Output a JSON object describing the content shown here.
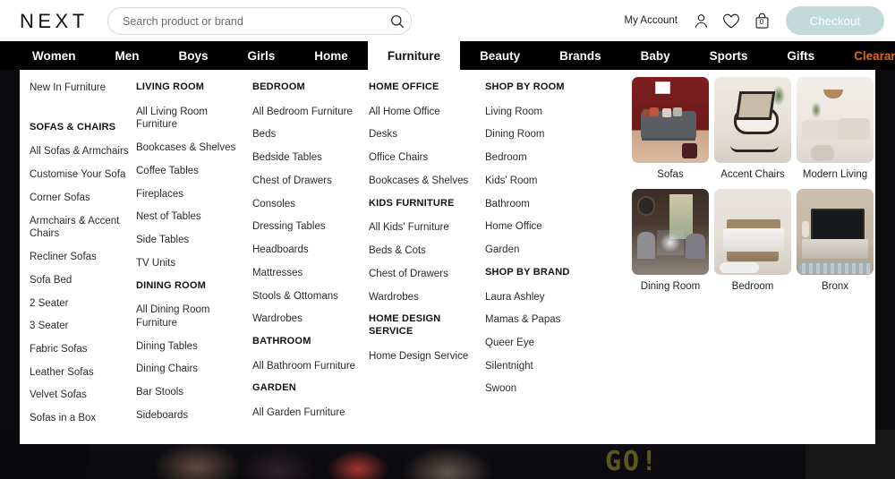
{
  "header": {
    "logo": "NEXT",
    "search": {
      "placeholder": "Search product or brand",
      "value": "",
      "icon": "search-icon"
    },
    "my_account": "My Account",
    "account_icon": "user-icon",
    "wishlist_icon": "heart-icon",
    "bag_icon": "bag-icon",
    "bag_count": "0",
    "checkout_label": "Checkout",
    "checkout_color": "#c2dadb"
  },
  "nav": {
    "items": [
      {
        "label": "Women",
        "active": false
      },
      {
        "label": "Men",
        "active": false
      },
      {
        "label": "Boys",
        "active": false
      },
      {
        "label": "Girls",
        "active": false
      },
      {
        "label": "Home",
        "active": false
      },
      {
        "label": "Furniture",
        "active": true
      },
      {
        "label": "Beauty",
        "active": false
      },
      {
        "label": "Brands",
        "active": false
      },
      {
        "label": "Baby",
        "active": false
      },
      {
        "label": "Sports",
        "active": false
      },
      {
        "label": "Gifts",
        "active": false
      },
      {
        "label": "Clearance",
        "active": false,
        "accent": "#e06a1c"
      }
    ]
  },
  "mega_menu": {
    "col1": {
      "top_link": "New In Furniture",
      "heading": "SOFAS & CHAIRS",
      "links": [
        "All Sofas & Armchairs",
        "Customise Your Sofa",
        "Corner Sofas",
        "Armchairs & Accent Chairs",
        "Recliner Sofas",
        "Sofa Bed",
        "2 Seater",
        "3 Seater",
        "Fabric Sofas",
        "Leather Sofas",
        "Velvet Sofas",
        "Sofas in a Box"
      ]
    },
    "col2": {
      "heading1": "LIVING ROOM",
      "links1": [
        "All Living Room Furniture",
        "Bookcases & Shelves",
        "Coffee Tables",
        "Fireplaces",
        "Nest of Tables",
        "Side Tables",
        "TV Units"
      ],
      "heading2": "DINING ROOM",
      "links2": [
        "All Dining Room Furniture",
        "Dining Tables",
        "Dining Chairs",
        "Bar Stools",
        "Sideboards"
      ]
    },
    "col3": {
      "heading1": "BEDROOM",
      "links1": [
        "All Bedroom Furniture",
        "Beds",
        "Bedside Tables",
        "Chest of Drawers",
        "Consoles",
        "Dressing Tables",
        "Headboards",
        "Mattresses",
        "Stools & Ottomans",
        "Wardrobes"
      ],
      "heading2": "BATHROOM",
      "links2": [
        "All Bathroom Furniture"
      ],
      "heading3": "GARDEN",
      "links3": [
        "All Garden Furniture"
      ]
    },
    "col4": {
      "heading1": "HOME OFFICE",
      "links1": [
        "All Home Office",
        "Desks",
        "Office Chairs",
        "Bookcases & Shelves"
      ],
      "heading2": "KIDS FURNITURE",
      "links2": [
        "All Kids' Furniture",
        "Beds & Cots",
        "Chest of Drawers",
        "Wardrobes"
      ],
      "heading3": "HOME DESIGN SERVICE",
      "links3": [
        "Home Design Service"
      ]
    },
    "col5": {
      "heading1": "SHOP BY ROOM",
      "links1": [
        "Living Room",
        "Dining Room",
        "Bedroom",
        "Kids' Room",
        "Bathroom",
        "Home Office",
        "Garden"
      ],
      "heading2": "SHOP BY BRAND",
      "links2": [
        "Laura Ashley",
        "Mamas & Papas",
        "Queer Eye",
        "Silentnight",
        "Swoon"
      ]
    },
    "tiles": [
      {
        "caption": "Sofas"
      },
      {
        "caption": "Accent Chairs"
      },
      {
        "caption": "Modern Living"
      },
      {
        "caption": "Dining Room"
      },
      {
        "caption": "Bedroom"
      },
      {
        "caption": "Bronx"
      }
    ]
  },
  "background": {
    "banner_text": "GO!"
  }
}
